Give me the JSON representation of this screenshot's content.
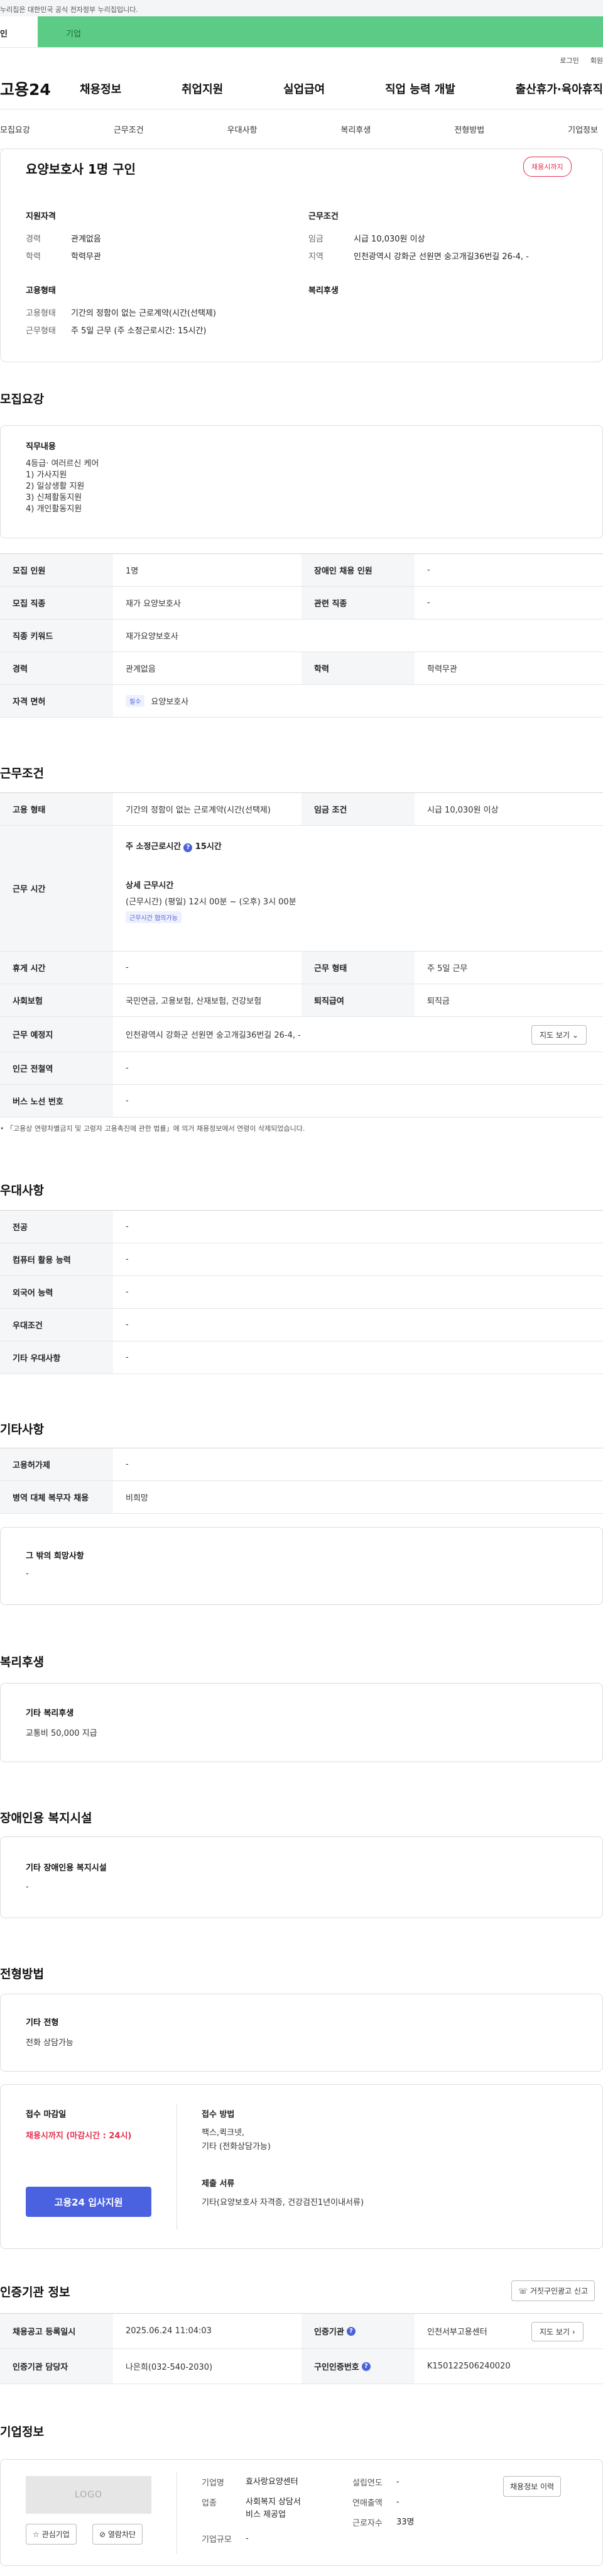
{
  "gov_bar": "누리집은 대한민국 공식 전자정부 누리집입니다.",
  "role_tabs": {
    "individual": "인",
    "company": "기업"
  },
  "util_links": [
    "로그인",
    "회원"
  ],
  "gnb": {
    "logo": "고용24",
    "menu": [
      "채용정보",
      "취업지원",
      "실업급여",
      "직업 능력 개발",
      "출산휴가·육아휴직"
    ]
  },
  "anchor_tabs": [
    "모집요강",
    "근무조건",
    "우대사항",
    "복리후생",
    "전형방법",
    "기업정보"
  ],
  "summary": {
    "title": "요양보호사 1명 구인",
    "badge": "채용시까지",
    "qualification": {
      "heading": "지원자격",
      "rows": [
        {
          "k": "경력",
          "v": "관계없음"
        },
        {
          "k": "학력",
          "v": "학력무관"
        }
      ]
    },
    "conditions": {
      "heading": "근무조건",
      "rows": [
        {
          "k": "임금",
          "v": "시급 10,030원 이상"
        },
        {
          "k": "지역",
          "v": "인천광역시 강화군 선원면 숭고개길36번길 26-4, -"
        }
      ]
    },
    "employment": {
      "heading": "고용형태",
      "rows": [
        {
          "k": "고용형태",
          "v": "기간의 정함이 없는 근로계약(시간(선택제)"
        },
        {
          "k": "근무형태",
          "v": "주 5일 근무 (주 소정근로시간: 15시간)"
        }
      ]
    },
    "welfare_heading": "복리후생"
  },
  "recruit": {
    "title": "모집요강",
    "duty_heading": "직무내용",
    "duty_lines": [
      "4등급· 여러르신 케어",
      "1) 가사지원",
      "2) 일상생활 지원",
      "3) 신체활동지원",
      "4) 개인활동지원"
    ],
    "table": {
      "r1": {
        "h1": "모집 인원",
        "v1": "1명",
        "h2": "장애인 채용 인원",
        "v2": "-"
      },
      "r2": {
        "h1": "모집 직종",
        "v1": "재가 요양보호사",
        "h2": "관련 직종",
        "v2": "-"
      },
      "r3": {
        "h1": "직종 키워드",
        "v1": "재가요양보호사"
      },
      "r4": {
        "h1": "경력",
        "v1": "관계없음",
        "h2": "학력",
        "v2": "학력무관"
      },
      "r5": {
        "h1": "자격 면허",
        "chip": "필수",
        "v1": "요양보호사"
      }
    }
  },
  "work": {
    "title": "근무조건",
    "r1": {
      "h1": "고용 형태",
      "v1": "기간의 정함이 없는 근로계약(시간(선택제)",
      "h2": "임금 조건",
      "v2": "시급 10,030원 이상"
    },
    "hours": {
      "h": "근무 시간",
      "weekly_label": "주 소정근로시간",
      "weekly_value": "15시간",
      "detail_label": "상세 근무시간",
      "detail_value": "(근무시간) (평일) 12시 00분 ~ (오후) 3시 00분",
      "chip": "근무시간 협의가능"
    },
    "r3": {
      "h1": "휴게 시간",
      "v1": "-",
      "h2": "근무 형태",
      "v2": "주 5일 근무"
    },
    "r4": {
      "h1": "사회보험",
      "v1": "국민연금, 고용보험, 산재보험, 건강보험",
      "h2": "퇴직급여",
      "v2": "퇴직금"
    },
    "r5": {
      "h1": "근무 예정지",
      "v1": "인천광역시 강화군 선원면 숭고개길36번길 26-4, -",
      "btn": "지도 보기"
    },
    "r6": {
      "h1": "인근 전철역",
      "v1": "-"
    },
    "r7": {
      "h1": "버스 노선 번호",
      "v1": "-"
    },
    "note": "「고용상 연령차별금지 및 고령자 고용촉진에 관한 법률」에 의거 채용정보에서 연령이 삭제되었습니다."
  },
  "preference": {
    "title": "우대사항",
    "rows": [
      {
        "h": "전공",
        "v": "-"
      },
      {
        "h": "컴퓨터 활용 능력",
        "v": "-"
      },
      {
        "h": "외국어 능력",
        "v": "-"
      },
      {
        "h": "우대조건",
        "v": "-"
      },
      {
        "h": "기타 우대사항",
        "v": "-"
      }
    ]
  },
  "etc": {
    "title": "기타사항",
    "rows": [
      {
        "h": "고용허가제",
        "v": "-"
      },
      {
        "h": "병역 대체 복무자 채용",
        "v": "비희망"
      }
    ],
    "wish_heading": "그 밖의 희망사항",
    "wish_value": "-"
  },
  "welfare": {
    "title": "복리후생",
    "heading": "기타 복리후생",
    "value": "교통비 50,000 지급"
  },
  "disabled": {
    "title": "장애인용 복지시설",
    "heading": "기타 장애인용 복지시설",
    "value": "-"
  },
  "selection": {
    "title": "전형방법",
    "heading": "기타 전형",
    "value": "전화 상담가능"
  },
  "apply": {
    "deadline_label": "접수 마감일",
    "deadline_value": "채용시까지 (마감시간 : 24시)",
    "button": "고용24 입사지원",
    "method_label": "접수 방법",
    "method_lines": [
      "팩스,퀵크넷,",
      "기타 (전화상담가능)"
    ],
    "docs_label": "제출 서류",
    "docs_value": "기타(요양보호사 자격증, 건강검진1년이내서류)"
  },
  "cert": {
    "title": "인증기관 정보",
    "ad_button": "거짓구인광고 신고",
    "r1": {
      "h1": "채용공고 등록일시",
      "v1": "2025.06.24 11:04:03",
      "h2": "인증기관",
      "v2": "인천서부고용센터",
      "btn": "지도 보기"
    },
    "r2": {
      "h1": "인증기관 담당자",
      "v1": "나은희(032-540-2030)",
      "h2": "구인인증번호",
      "v2": "K150122506240020"
    }
  },
  "company": {
    "title": "기업정보",
    "logo": "LOGO",
    "interest_btn": "관심기업",
    "block_btn": "열람차단",
    "history_btn": "채용정보 이력",
    "left": [
      {
        "k": "기업명",
        "v": [
          "효사랑요양센터"
        ]
      },
      {
        "k": "업종",
        "v": [
          "사회복지 상담서",
          "비스 제공업"
        ]
      },
      {
        "k": "기업규모",
        "v": [
          "-"
        ]
      }
    ],
    "right": [
      {
        "k": "설립연도",
        "v": "-"
      },
      {
        "k": "연매출액",
        "v": "-"
      },
      {
        "k": "근로자수",
        "v": "33명"
      }
    ]
  }
}
